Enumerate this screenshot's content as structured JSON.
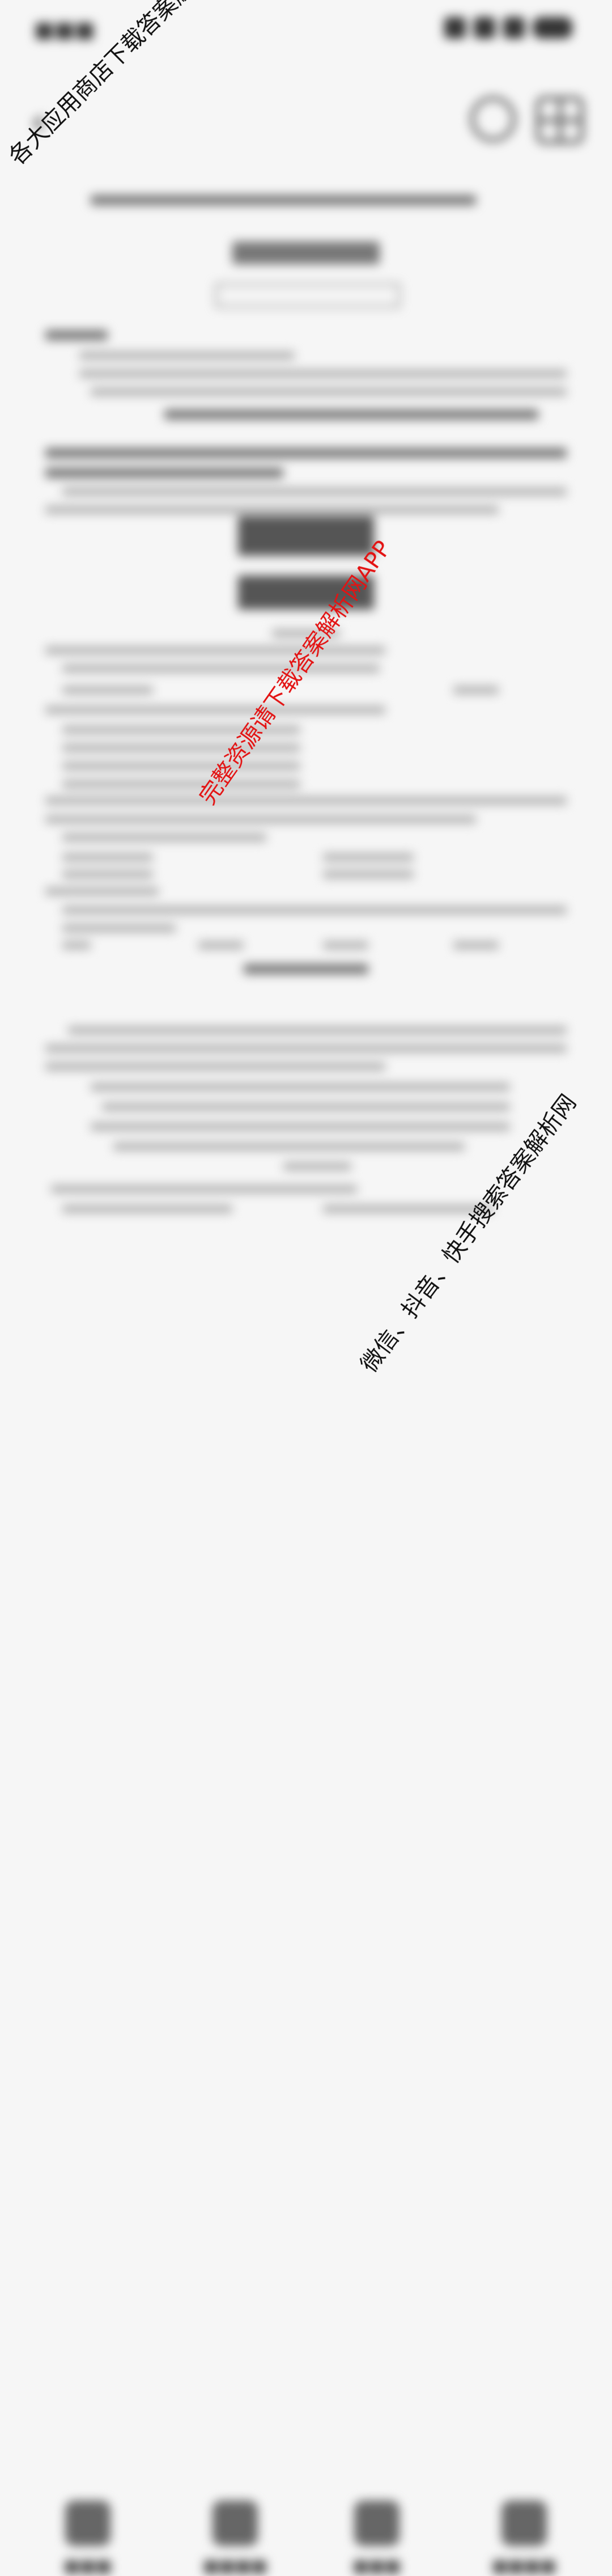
{
  "watermarks": {
    "top_left": "各大应用商店下载答案解析网APP",
    "center": "完整资源请下载答案解析网APP",
    "bottom_right": "微信、抖音、快手搜索答案解析网"
  },
  "colors": {
    "background": "#f6f6f6",
    "watermark_center": "#e31313",
    "watermark_default": "#111111"
  },
  "icons": [
    "back-icon",
    "history-icon",
    "grid-icon",
    "tab-icon"
  ]
}
